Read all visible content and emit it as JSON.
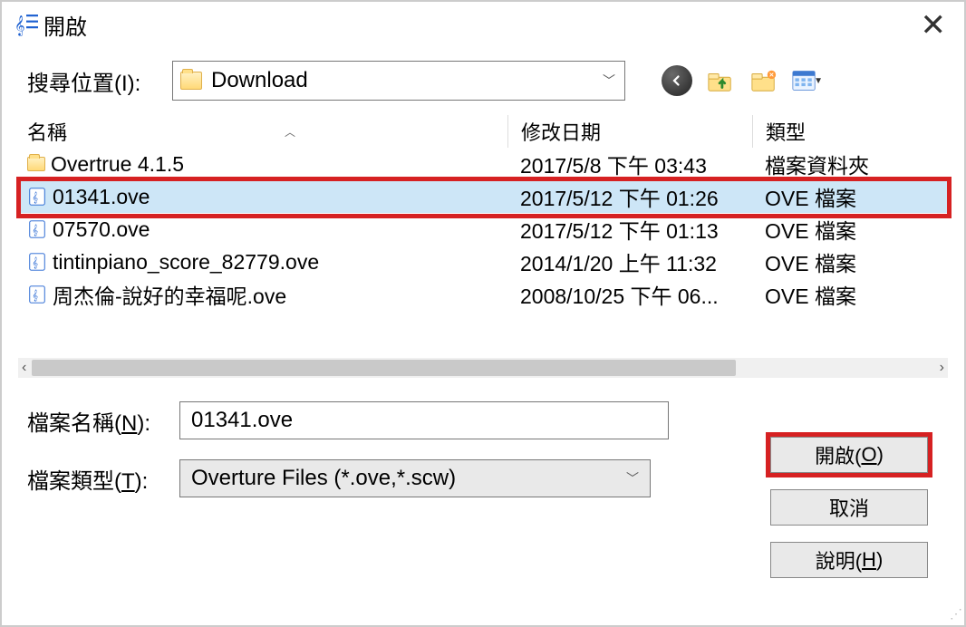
{
  "window": {
    "title": "開啟"
  },
  "lookin": {
    "label": "搜尋位置(I):",
    "location": "Download"
  },
  "columns": {
    "name": "名稱",
    "date": "修改日期",
    "type": "類型"
  },
  "files": [
    {
      "icon": "folder",
      "name": "Overtrue 4.1.5",
      "date": "2017/5/8 下午 03:43",
      "type_label": "檔案資料夾",
      "selected": false
    },
    {
      "icon": "ove",
      "name": "01341.ove",
      "date": "2017/5/12 下午 01:26",
      "type_label": "OVE 檔案",
      "selected": true
    },
    {
      "icon": "ove",
      "name": "07570.ove",
      "date": "2017/5/12 下午 01:13",
      "type_label": "OVE 檔案",
      "selected": false
    },
    {
      "icon": "ove",
      "name": "tintinpiano_score_82779.ove",
      "date": "2014/1/20 上午 11:32",
      "type_label": "OVE 檔案",
      "selected": false
    },
    {
      "icon": "ove",
      "name": "周杰倫-說好的幸福呢.ove",
      "date": "2008/10/25 下午 06...",
      "type_label": "OVE 檔案",
      "selected": false
    }
  ],
  "form": {
    "filename_label_pre": "檔案名稱(",
    "filename_key": "N",
    "filename_label_post": "):",
    "filename_value": "01341.ove",
    "filetype_label_pre": "檔案類型(",
    "filetype_key": "T",
    "filetype_label_post": "):",
    "filetype_value": "Overture Files (*.ove,*.scw)"
  },
  "buttons": {
    "open_pre": "開啟(",
    "open_key": "O",
    "open_post": ")",
    "cancel": "取消",
    "help_pre": "說明(",
    "help_key": "H",
    "help_post": ")"
  }
}
